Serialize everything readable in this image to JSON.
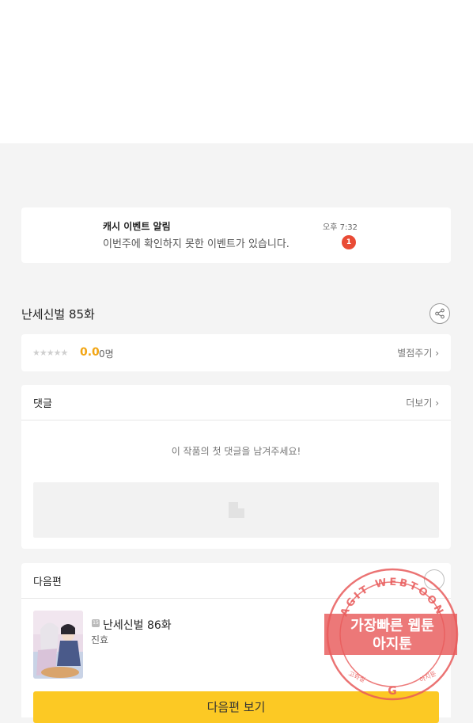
{
  "notification": {
    "app": "캐시 이벤트 알림",
    "message": "이번주에 확인하지 못한 이벤트가 있습니다.",
    "time": "오후 7:32",
    "badge_count": "1"
  },
  "episode": {
    "title": "난세신벌 85화",
    "share_icon": "share-icon"
  },
  "rating": {
    "stars": "★★★★★",
    "score": "0.0",
    "count": "0명",
    "rate_link": "별점주기 ›"
  },
  "comments": {
    "title": "댓글",
    "more": "더보기 ›",
    "empty_message": "이 작품의 첫 댓글을 남겨주세요!"
  },
  "next_episode": {
    "section_title": "다음편",
    "age_badge": "15",
    "title": "난세신벌 86화",
    "author": "진효",
    "button": "다음편 보기",
    "bell_icon": "bell-icon"
  },
  "watermark": {
    "ring_text": "AGIT WEBTOON",
    "line1": "가장빠른 웹툰",
    "line2": "아지툰",
    "bottom_left": "고화질",
    "bottom_right": "아지툰",
    "bottom_mark": "G"
  },
  "colors": {
    "accent_yellow": "#fcc924",
    "score_orange": "#f2a513",
    "badge_red": "#e94b35",
    "watermark_red": "#e85a5a"
  }
}
